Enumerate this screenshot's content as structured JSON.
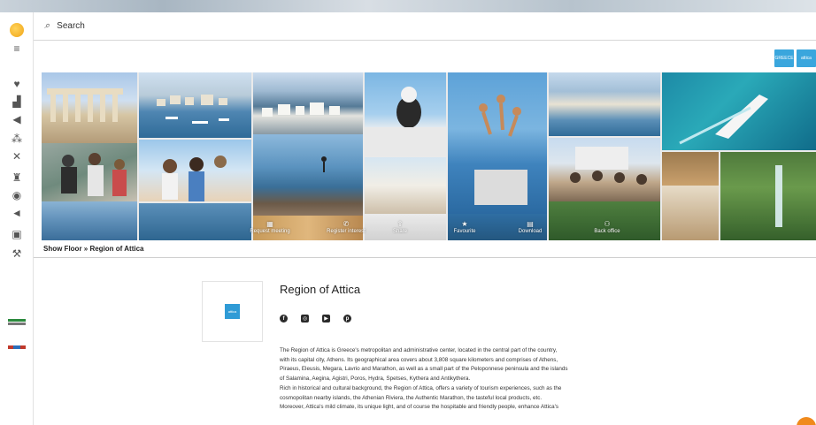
{
  "search": {
    "placeholder": "Search"
  },
  "sidebar": {
    "items": [
      {
        "icon": "menu-icon",
        "glyph": "≡"
      },
      {
        "icon": "heart-icon",
        "glyph": "♥"
      },
      {
        "icon": "thumbs-up-icon",
        "glyph": "▟"
      },
      {
        "icon": "tag-icon",
        "glyph": "◀"
      },
      {
        "icon": "handshake-icon",
        "glyph": "⁂"
      },
      {
        "icon": "tools-icon",
        "glyph": "✕"
      },
      {
        "icon": "trophy-icon",
        "glyph": "♜"
      },
      {
        "icon": "location-pin-icon",
        "glyph": "◉"
      },
      {
        "icon": "megaphone-icon",
        "glyph": "◄"
      },
      {
        "icon": "building-icon",
        "glyph": "▣"
      },
      {
        "icon": "wrench-icon",
        "glyph": "⚒"
      }
    ]
  },
  "actions": [
    {
      "label": "Request meeting",
      "icon": "calendar-icon",
      "glyph": "▦"
    },
    {
      "label": "Register interest",
      "icon": "phone-icon",
      "glyph": "✆"
    },
    {
      "label": "Share",
      "icon": "share-icon",
      "glyph": "⇪"
    },
    {
      "label": "Favourite",
      "icon": "star-icon",
      "glyph": "★"
    },
    {
      "label": "Download",
      "icon": "download-icon",
      "glyph": "▤"
    },
    {
      "label": "Back office",
      "icon": "users-icon",
      "glyph": "⚇"
    }
  ],
  "breadcrumb": {
    "text": "Show Floor » Region of Attica"
  },
  "company": {
    "name": "Region of Attica",
    "logo_text": "attica",
    "description": [
      "The Region of Attica is Greece's metropolitan and administrative center, located in the central part of the country,",
      "with its capital city, Athens. Its geographical area covers about 3,808 square kilometers and comprises of Athens,",
      "Piraeus, Eleusis, Megara, Lavrio and Marathon, as well as a small part of the Peloponnese peninsula and the islands",
      "of Salamina, Aegina, Agistri, Poros, Hydra, Spetses, Kythera and Antikythera.",
      "Rich in historical and cultural background, the Region of Attica, offers a variety of tourism experiences, such as the",
      "cosmopolitan nearby islands, the Athenian Riviera, the Authentic Marathon, the tasteful local products, etc.",
      "Moreover, Attica's mild climate, its unique light, and of course the hospitable and friendly people, enhance Attica's"
    ]
  },
  "top_buttons": [
    {
      "label": "GREECE"
    },
    {
      "label": "attica"
    }
  ],
  "colors": {
    "accent": "#3aa6dd",
    "fab": "#f08a1c"
  }
}
